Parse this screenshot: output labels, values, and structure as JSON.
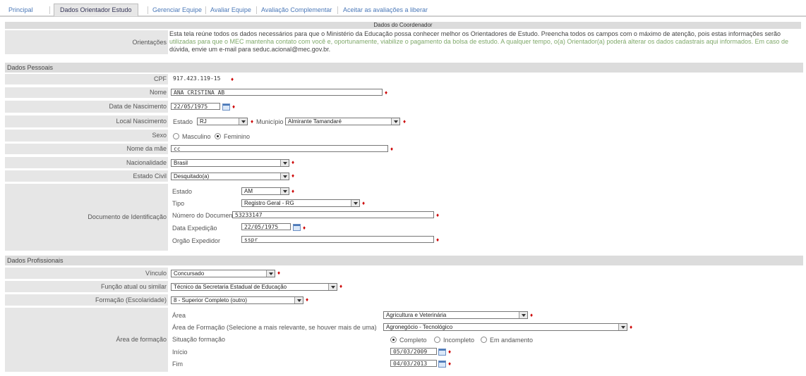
{
  "tabs": [
    {
      "label": "Principal"
    },
    {
      "label": "Dados Orientador Estudo"
    },
    {
      "label": "Gerenciar Equipe"
    },
    {
      "label": "Avaliar Equipe"
    },
    {
      "label": "Avaliação Complementar"
    },
    {
      "label": "Aceitar as avaliações a liberar"
    }
  ],
  "header": {
    "title": "Dados do Coordenador"
  },
  "orientacoes": {
    "label": "Orientações",
    "line1": "Esta tela reúne todos os dados necessários para que o Ministério da Educação possa conhecer melhor os Orientadores de Estudo. Preencha todos os campos com o máximo de atenção, pois estas informações serão",
    "line2": "utilizadas para que o MEC mantenha contato com você e, oportunamente, viabilize o pagamento da bolsa de estudo. A qualquer tempo, o(a) Orientador(a) poderá alterar os dados cadastrais aqui informados. Em caso de",
    "line3": "dúvida, envie um e-mail para seduc.acional@mec.gov.br."
  },
  "sections": {
    "pessoais": "Dados Pessoais",
    "profissionais": "Dados Profissionais"
  },
  "pessoais": {
    "cpf_label": "CPF",
    "cpf": "917.423.119-15",
    "nome_label": "Nome",
    "nome": "ANA CRISTINA AB",
    "nasc_label": "Data de Nascimento",
    "nasc": "22/05/1975",
    "local_label": "Local Nascimento",
    "estado_label": "Estado",
    "estado": "RJ",
    "municipio_label": "Município",
    "municipio": "Almirante Tamandaré",
    "sexo_label": "Sexo",
    "masc": "Masculino",
    "fem": "Feminino",
    "mae_label": "Nome da mãe",
    "mae": "cc",
    "nac_label": "Nacionalidade",
    "nac": "Brasil",
    "civil_label": "Estado Civil",
    "civil": "Desquitado(a)",
    "doc_label": "Documento de Identificação",
    "doc_estado_label": "Estado",
    "doc_estado": "AM",
    "tipo_label": "Tipo",
    "tipo": "Registro Geral - RG",
    "numero_label": "Número do Documento",
    "numero": "53233147",
    "exped_label": "Data Expedição",
    "exped": "22/05/1975",
    "orgao_label": "Orgão Expedidor",
    "orgao": "sspr"
  },
  "profissionais": {
    "vinculo_label": "Vínculo",
    "vinculo": "Concursado",
    "funcao_label": "Função atual ou similar",
    "funcao": "Técnico da Secretaria Estadual de Educação",
    "formacao_label": "Formação (Escolaridade)",
    "formacao": "8 - Superior Completo (outro)",
    "area_label": "Área de formação",
    "area_sub_label": "Área",
    "area": "Agricultura e Veterinária",
    "area_form_label": "Área de Formação (Selecione a mais relevante, se houver mais de uma)",
    "area_form": "Agronegócio - Tecnológico",
    "situacao_label": "Situação formação",
    "completo": "Completo",
    "incompleto": "Incompleto",
    "andamento": "Em andamento",
    "inicio_label": "Início",
    "inicio": "05/03/2009",
    "fim_label": "Fim",
    "fim": "04/03/2013"
  },
  "colors": {
    "tab_link": "#4a78b8",
    "required": "#cc0000",
    "label_bg": "#e6e6e6",
    "header_bg": "#dcdcdc"
  }
}
